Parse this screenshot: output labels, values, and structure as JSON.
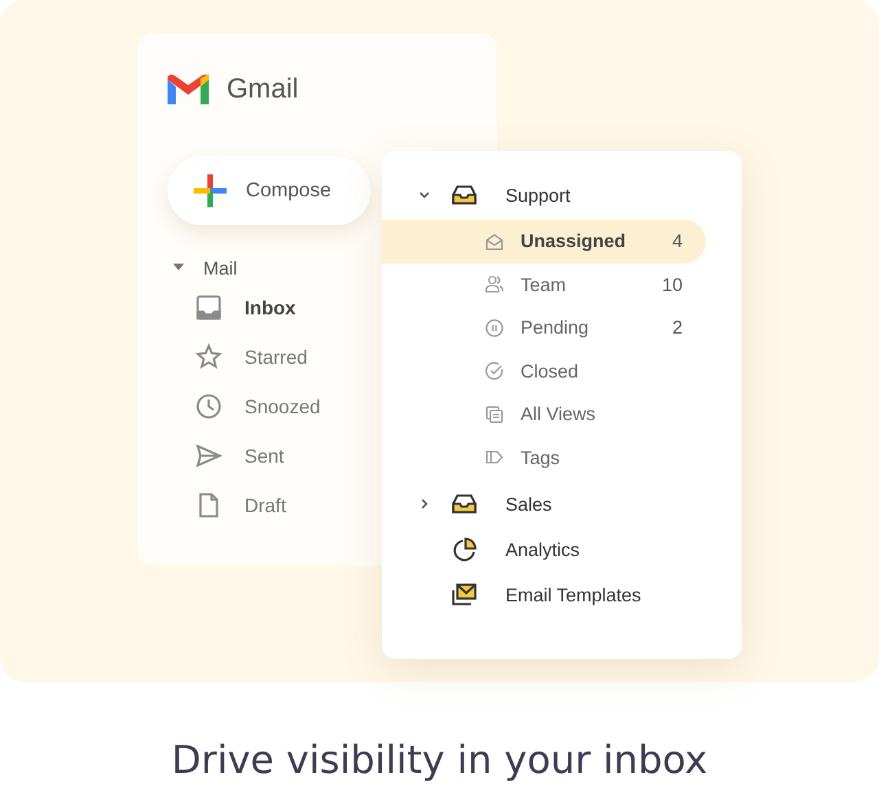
{
  "gmail": {
    "title": "Gmail",
    "compose": "Compose",
    "section": {
      "label": "Mail",
      "expanded": true
    },
    "items": [
      {
        "label": "Inbox",
        "kind": "inbox",
        "selected": true
      },
      {
        "label": "Starred",
        "kind": "star",
        "selected": false
      },
      {
        "label": "Snoozed",
        "kind": "clock",
        "selected": false
      },
      {
        "label": "Sent",
        "kind": "send",
        "selected": false
      },
      {
        "label": "Draft",
        "kind": "draft",
        "selected": false
      }
    ]
  },
  "panel": {
    "items": [
      {
        "label": "Support",
        "kind": "folder",
        "expanded": true,
        "children": [
          {
            "label": "Unassigned",
            "kind": "envelope",
            "count": "4",
            "selected": true
          },
          {
            "label": "Team",
            "kind": "people",
            "count": "10",
            "selected": false
          },
          {
            "label": "Pending",
            "kind": "pause",
            "count": "2",
            "selected": false
          },
          {
            "label": "Closed",
            "kind": "check",
            "selected": false
          },
          {
            "label": "All Views",
            "kind": "views",
            "selected": false
          },
          {
            "label": "Tags",
            "kind": "tag",
            "selected": false
          }
        ]
      },
      {
        "label": "Sales",
        "kind": "folder",
        "expanded": false
      },
      {
        "label": "Analytics",
        "kind": "chart"
      },
      {
        "label": "Email Templates",
        "kind": "templates"
      }
    ]
  },
  "caption": "Drive visibility in your inbox"
}
